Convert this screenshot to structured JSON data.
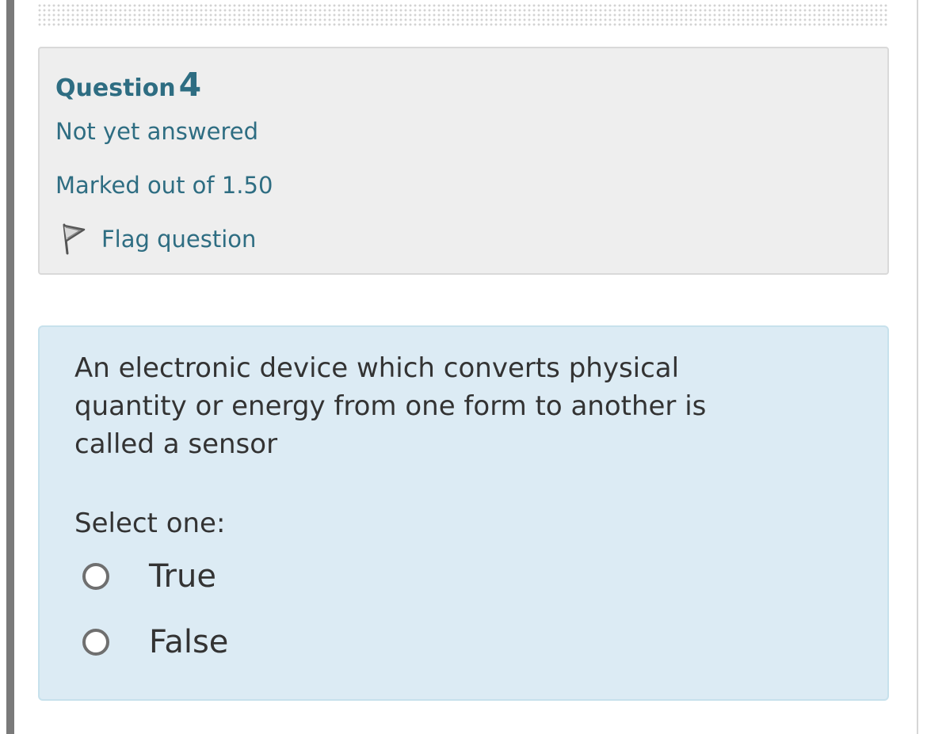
{
  "question": {
    "label": "Question",
    "number": "4",
    "status": "Not yet answered",
    "marks": "Marked out of 1.50",
    "flag_label": "Flag question"
  },
  "content": {
    "question_text": "An electronic device which converts physical quantity or energy from one form to another is called a sensor",
    "prompt": "Select one:",
    "options": [
      {
        "label": "True"
      },
      {
        "label": "False"
      }
    ]
  },
  "colors": {
    "accent": "#2e6d82",
    "info_bg": "#eeeeee",
    "question_bg": "#dcebf4"
  },
  "icons": {
    "flag": "flag-outline-icon",
    "radio": "radio-unchecked-icon"
  }
}
